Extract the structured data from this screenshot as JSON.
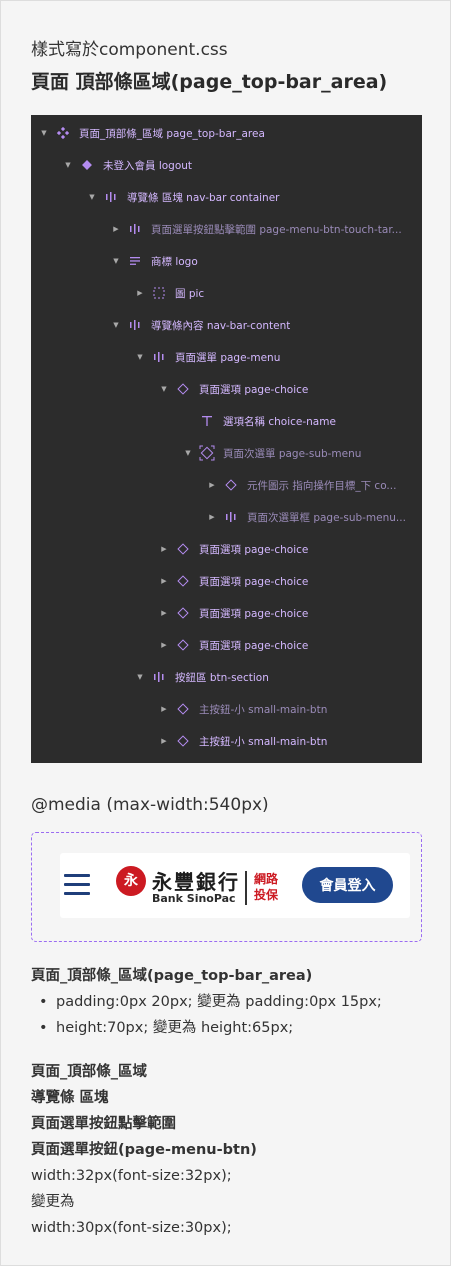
{
  "heading_small": "樣式寫於component.css",
  "heading_big": "頁面 頂部條區域(page_top-bar_area)",
  "layers": [
    {
      "label": "頁面_頂部條_區域 page_top-bar_area",
      "arrow": "down",
      "icon": "component-icon",
      "indent": 0,
      "dim": false
    },
    {
      "label": "未登入會員 logout",
      "arrow": "down",
      "icon": "instance-icon",
      "indent": 1,
      "dim": false
    },
    {
      "label": "導覽條 區塊 nav-bar container",
      "arrow": "down",
      "icon": "auto-layout-icon",
      "indent": 2,
      "dim": false
    },
    {
      "label": "頁面選單按鈕點擊範圍 page-menu-btn-touch-tar...",
      "arrow": "right",
      "icon": "auto-layout-icon",
      "indent": 3,
      "dim": true
    },
    {
      "label": "商標 logo",
      "arrow": "down",
      "icon": "text-align-icon",
      "indent": 3,
      "dim": false
    },
    {
      "label": "圖 pic",
      "arrow": "right",
      "icon": "frame-dashed-icon",
      "indent": 4,
      "dim": false
    },
    {
      "label": "導覽條內容 nav-bar-content",
      "arrow": "down",
      "icon": "auto-layout-icon",
      "indent": 3,
      "dim": false
    },
    {
      "label": "頁面選單 page-menu",
      "arrow": "down",
      "icon": "auto-layout-icon",
      "indent": 4,
      "dim": false
    },
    {
      "label": "頁面選項 page-choice",
      "arrow": "down",
      "icon": "instance-outline-icon",
      "indent": 5,
      "dim": false
    },
    {
      "label": "選項名稱 choice-name",
      "arrow": "none",
      "icon": "text-icon",
      "indent": 6,
      "dim": false
    },
    {
      "label": "頁面次選單 page-sub-menu",
      "arrow": "down",
      "icon": "instance-dashed-icon",
      "indent": 6,
      "dim": true
    },
    {
      "label": "元件圖示 指向操作目標_下 co...",
      "arrow": "right",
      "icon": "instance-outline-icon",
      "indent": 7,
      "dim": true
    },
    {
      "label": "頁面次選單框 page-sub-menu...",
      "arrow": "right",
      "icon": "auto-layout-icon",
      "indent": 7,
      "dim": true
    },
    {
      "label": "頁面選項 page-choice",
      "arrow": "right",
      "icon": "instance-outline-icon",
      "indent": 5,
      "dim": false
    },
    {
      "label": "頁面選項 page-choice",
      "arrow": "right",
      "icon": "instance-outline-icon",
      "indent": 5,
      "dim": false
    },
    {
      "label": "頁面選項 page-choice",
      "arrow": "right",
      "icon": "instance-outline-icon",
      "indent": 5,
      "dim": false
    },
    {
      "label": "頁面選項 page-choice",
      "arrow": "right",
      "icon": "instance-outline-icon",
      "indent": 5,
      "dim": false
    },
    {
      "label": "按鈕區 btn-section",
      "arrow": "down",
      "icon": "auto-layout-icon",
      "indent": 4,
      "dim": false
    },
    {
      "label": "主按鈕-小 small-main-btn",
      "arrow": "right",
      "icon": "instance-outline-icon",
      "indent": 5,
      "dim": true
    },
    {
      "label": "主按鈕-小 small-main-btn",
      "arrow": "right",
      "icon": "instance-outline-icon",
      "indent": 5,
      "dim": false
    }
  ],
  "media_query": "@media (max-width:540px)",
  "preview": {
    "logo_mark": "永",
    "logo_cn": "永豐銀行",
    "logo_en": "Bank SinoPac",
    "logo_sub": "網路投保",
    "login_label": "會員登入",
    "brand_color": "#20488f",
    "logo_red": "#cc1a22"
  },
  "notes": {
    "section1_title": "頁面_頂部條_區域(page_top-bar_area)",
    "section1_items": [
      "padding:0px 20px; 變更為 padding:0px 15px;",
      "height:70px; 變更為 height:65px;"
    ],
    "section2_lines": [
      "頁面_頂部條_區域",
      "導覽條 區塊",
      "頁面選單按鈕點擊範圍",
      "頁面選單按鈕(page-menu-btn)"
    ],
    "section2_plain": [
      "width:32px(font-size:32px);",
      "變更為",
      "width:30px(font-size:30px);"
    ]
  }
}
